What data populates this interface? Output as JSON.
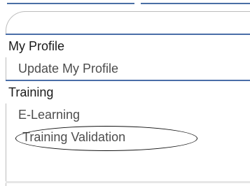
{
  "menu": {
    "sections": [
      {
        "title": "My Profile",
        "items": [
          "Update My Profile"
        ]
      },
      {
        "title": "Training",
        "items": [
          "E-Learning",
          "Training Validation"
        ]
      }
    ]
  },
  "highlighted_item": "Training Validation",
  "colors": {
    "rule": "#4a6ea8",
    "item_text": "#4d4d4d",
    "header_text": "#1a1a1a"
  }
}
